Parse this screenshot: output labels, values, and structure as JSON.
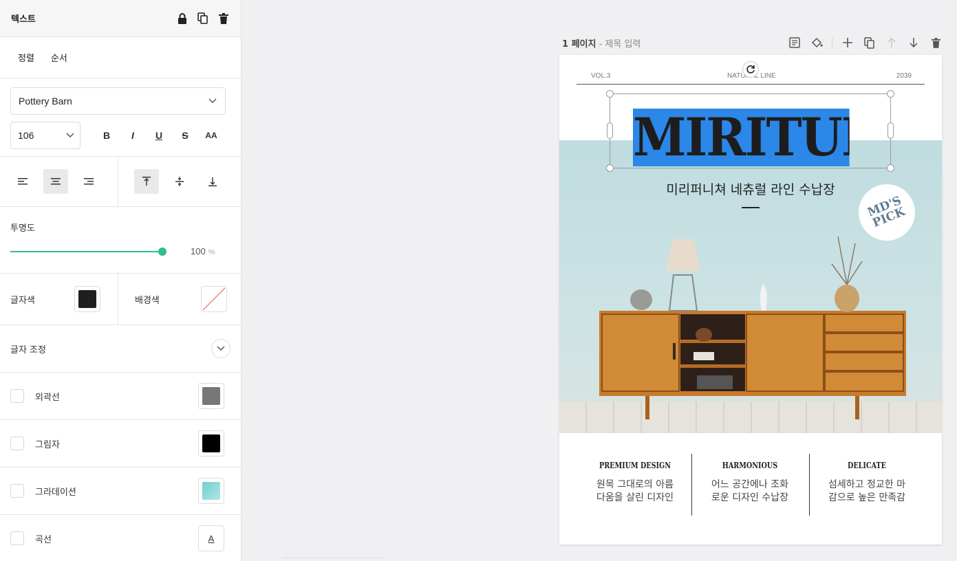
{
  "panel": {
    "title": "텍스트",
    "tabs": [
      "정렬",
      "순서"
    ],
    "font_family": "Pottery Barn",
    "font_size": "106",
    "style_buttons": {
      "bold": "B",
      "italic": "I",
      "underline": "U",
      "strike": "S",
      "caps": "AA"
    },
    "opacity_label": "투명도",
    "opacity_value": "100",
    "opacity_unit": "%",
    "text_color_label": "글자색",
    "text_color": "#1f1f1f",
    "bg_color_label": "배경색",
    "adjust_label": "글자 조정",
    "options": [
      {
        "label": "외곽선",
        "color": "#777777"
      },
      {
        "label": "그림자",
        "color": "#000000"
      },
      {
        "label": "그라데이션",
        "color": "#8fd6d4"
      },
      {
        "label": "곡선",
        "icon": "A"
      }
    ]
  },
  "page": {
    "page_label": "1 페이지",
    "page_sub": " - 제목 입력",
    "vol": "VOL.3",
    "line": "NATURAL LINE",
    "year": "2039",
    "title": "MIRITURE",
    "subtitle": "미리퍼니쳐 네츄럴 라인 수납장",
    "badge": "MD'S PICK",
    "columns": [
      {
        "title": "PREMIUM DESIGN",
        "desc1": "원목 그대로의 아름",
        "desc2": "다움을 살린 디자인"
      },
      {
        "title": "HARMONIOUS",
        "desc1": "어느 공간에나 조화",
        "desc2": "로운 디자인 수납장"
      },
      {
        "title": "DELICATE",
        "desc1": "섬세하고 정교한 마",
        "desc2": "감으로 높은 만족감"
      }
    ]
  },
  "colors": {
    "accent": "#2fbf88",
    "selection": "#2b87e8"
  }
}
